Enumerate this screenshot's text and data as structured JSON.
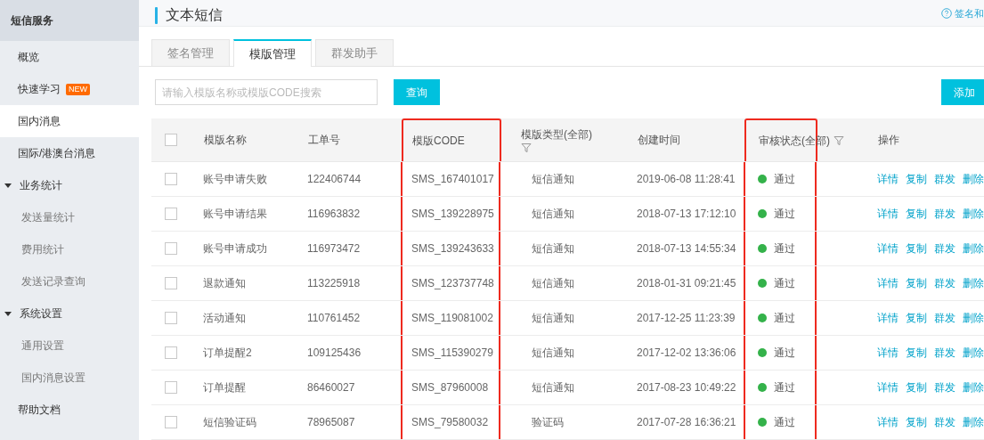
{
  "sidebar": {
    "title": "短信服务",
    "items": [
      {
        "label": "概览",
        "selected": false
      },
      {
        "label": "快速学习",
        "badge": "NEW",
        "selected": false
      },
      {
        "label": "国内消息",
        "selected": true
      },
      {
        "label": "国际/港澳台消息",
        "selected": false
      },
      {
        "label": "业务统计",
        "selected": false,
        "expanded": true,
        "children": [
          {
            "label": "发送量统计",
            "selected": false
          },
          {
            "label": "费用统计",
            "selected": false
          },
          {
            "label": "发送记录查询",
            "selected": false
          }
        ]
      },
      {
        "label": "系统设置",
        "selected": false,
        "expanded": true,
        "children": [
          {
            "label": "通用设置",
            "selected": false
          },
          {
            "label": "国内消息设置",
            "selected": false
          }
        ]
      },
      {
        "label": "帮助文档",
        "selected": false
      }
    ]
  },
  "header": {
    "title": "文本短信",
    "help_link": "签名和"
  },
  "tabs": [
    {
      "label": "签名管理",
      "selected": false
    },
    {
      "label": "模版管理",
      "selected": true
    },
    {
      "label": "群发助手",
      "selected": false
    }
  ],
  "search": {
    "placeholder": "请输入模版名称或模版CODE搜索"
  },
  "query_button": "查询",
  "add_button": "添加",
  "table": {
    "select_all": {
      "checked": false
    },
    "columns": [
      {
        "label": "模版名称",
        "filter": false,
        "highlighted": false
      },
      {
        "label": "工单号",
        "filter": false,
        "highlighted": false
      },
      {
        "label": "模版CODE",
        "filter": false,
        "highlighted": true
      },
      {
        "label": "模版类型(全部)",
        "filter": true,
        "highlighted": false
      },
      {
        "label": "创建时间",
        "filter": false,
        "highlighted": false
      },
      {
        "label": "审核状态(全部)",
        "filter": true,
        "highlighted": true
      },
      {
        "label": "操作",
        "filter": false,
        "highlighted": false
      }
    ],
    "rows": [
      {
        "checked": false,
        "name": "账号申请失败",
        "ticket": "122406744",
        "code": "SMS_167401017",
        "type": "短信通知",
        "created": "2019-06-08 11:28:41",
        "status": {
          "label": "通过",
          "color": "#34b24a"
        },
        "actions": [
          "详情",
          "复制",
          "群发",
          "删除"
        ]
      },
      {
        "checked": false,
        "name": "账号申请结果",
        "ticket": "116963832",
        "code": "SMS_139228975",
        "type": "短信通知",
        "created": "2018-07-13 17:12:10",
        "status": {
          "label": "通过",
          "color": "#34b24a"
        },
        "actions": [
          "详情",
          "复制",
          "群发",
          "删除"
        ]
      },
      {
        "checked": false,
        "name": "账号申请成功",
        "ticket": "116973472",
        "code": "SMS_139243633",
        "type": "短信通知",
        "created": "2018-07-13 14:55:34",
        "status": {
          "label": "通过",
          "color": "#34b24a"
        },
        "actions": [
          "详情",
          "复制",
          "群发",
          "删除"
        ]
      },
      {
        "checked": false,
        "name": "退款通知",
        "ticket": "113225918",
        "code": "SMS_123737748",
        "type": "短信通知",
        "created": "2018-01-31 09:21:45",
        "status": {
          "label": "通过",
          "color": "#34b24a"
        },
        "actions": [
          "详情",
          "复制",
          "群发",
          "删除"
        ]
      },
      {
        "checked": false,
        "name": "活动通知",
        "ticket": "110761452",
        "code": "SMS_119081002",
        "type": "短信通知",
        "created": "2017-12-25 11:23:39",
        "status": {
          "label": "通过",
          "color": "#34b24a"
        },
        "actions": [
          "详情",
          "复制",
          "群发",
          "删除"
        ]
      },
      {
        "checked": false,
        "name": "订单提醒2",
        "ticket": "109125436",
        "code": "SMS_115390279",
        "type": "短信通知",
        "created": "2017-12-02 13:36:06",
        "status": {
          "label": "通过",
          "color": "#34b24a"
        },
        "actions": [
          "详情",
          "复制",
          "群发",
          "删除"
        ]
      },
      {
        "checked": false,
        "name": "订单提醒",
        "ticket": "86460027",
        "code": "SMS_87960008",
        "type": "短信通知",
        "created": "2017-08-23 10:49:22",
        "status": {
          "label": "通过",
          "color": "#34b24a"
        },
        "actions": [
          "详情",
          "复制",
          "群发",
          "删除"
        ]
      },
      {
        "checked": false,
        "name": "短信验证码",
        "ticket": "78965087",
        "code": "SMS_79580032",
        "type": "验证码",
        "created": "2017-07-28 16:36:21",
        "status": {
          "label": "通过",
          "color": "#34b24a"
        },
        "actions": [
          "详情",
          "复制",
          "群发",
          "删除"
        ]
      }
    ]
  }
}
